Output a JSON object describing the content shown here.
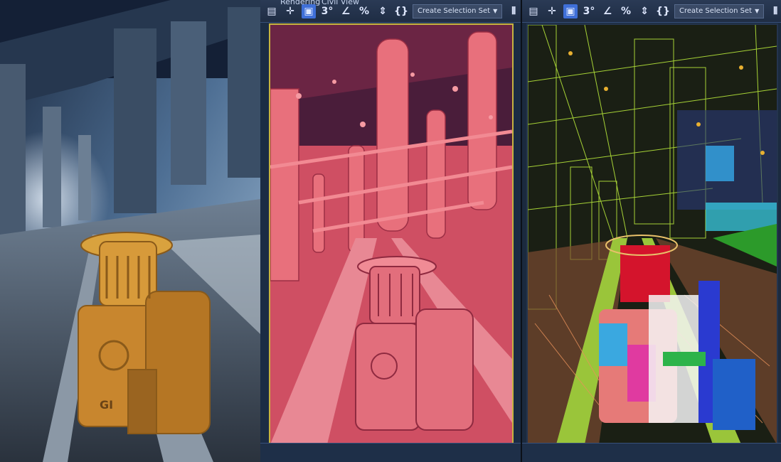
{
  "menu": {
    "item_rendering": "Rendering",
    "item_view": "Civil View"
  },
  "toolbar": {
    "create_selection_set": "Create Selection Set",
    "icons": [
      "select-icon",
      "move-icon",
      "active-select-icon",
      "snap-3d-icon",
      "angle-snap-icon",
      "percent-snap-icon",
      "spinner-snap-icon",
      "named-selection-icon",
      "mirror-icon",
      "align-icon",
      "layers-icon"
    ]
  },
  "panels": [
    "final-render",
    "shaded-viewport",
    "wireframe-viewport"
  ],
  "colors": {
    "shaded": "#e25a6a",
    "wire_green": "#b6e63a",
    "wire_orange": "#e8915a",
    "viewport_border": "#c7b340",
    "ui_blue": "#3f6fd8"
  }
}
